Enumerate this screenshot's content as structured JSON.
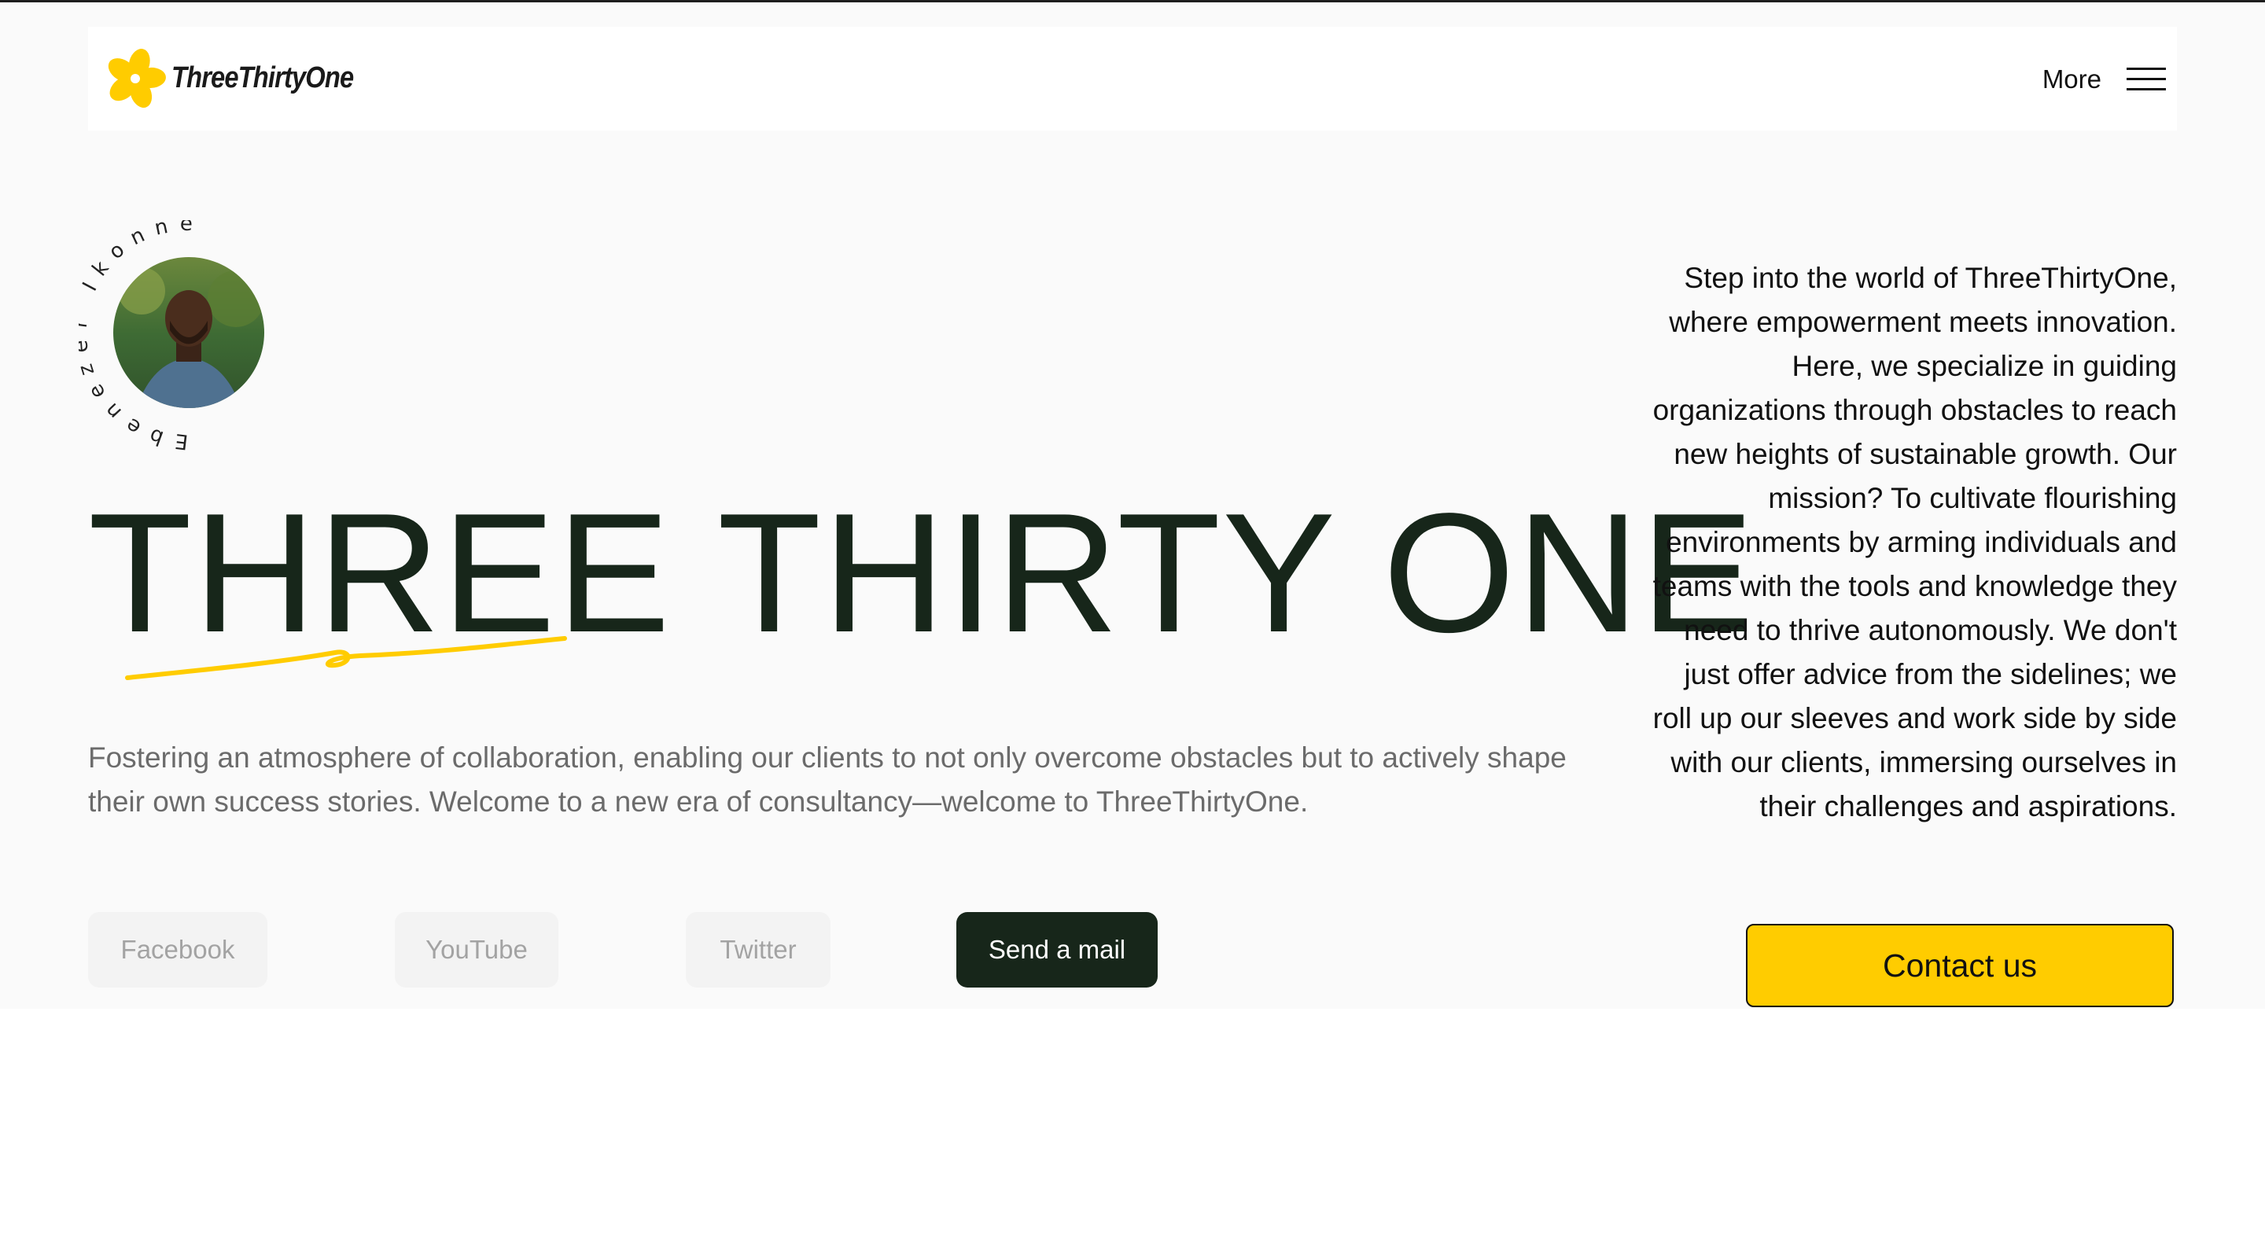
{
  "brand": {
    "name": "ThreeThirtyOne",
    "accent_color": "#ffcc00",
    "dark_color": "#17261a"
  },
  "header": {
    "more_label": "More",
    "menu_icon": "hamburger-icon"
  },
  "profile": {
    "circle_text": "Ebenezer Ikonne",
    "photo": "portrait-photo"
  },
  "hero": {
    "title": "THREE THIRTY ONE",
    "tagline": "Fostering an atmosphere of collaboration, enabling our clients to not only overcome obstacles but to actively shape their own success stories. Welcome to a new era of consultancy—welcome to ThreeThirtyOne."
  },
  "social": {
    "facebook": "Facebook",
    "youtube": "YouTube",
    "twitter": "Twitter",
    "mail": "Send a mail"
  },
  "intro": {
    "text": "Step into the world of ThreeThirtyOne, where empowerment meets innovation. Here, we specialize in guiding organizations through obstacles to reach new heights of sustainable growth. Our mission? To cultivate flourishing environments by arming individuals and teams with the tools and knowledge they need to thrive autonomously. We don't just offer advice from the sidelines; we roll up our sleeves and work side by side with our clients, immersing ourselves in their challenges and aspirations."
  },
  "cta": {
    "contact_label": "Contact us"
  }
}
